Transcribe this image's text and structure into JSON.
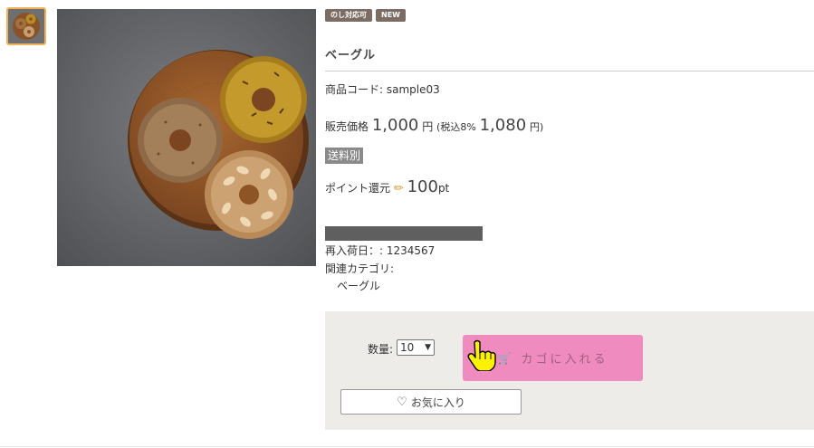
{
  "product": {
    "badges": [
      "のし対応可",
      "NEW"
    ],
    "title": "ベーグル",
    "code_label": "商品コード:",
    "code_value": "sample03",
    "price": {
      "label": "販売価格",
      "amount": "1,000",
      "yen": "円",
      "tax_open": "(税込8%",
      "tax_amount": "1,080",
      "tax_close": "円)"
    },
    "shipping": "送料別",
    "point": {
      "label": "ポイント還元",
      "icon": "pencil-icon",
      "amount": "100",
      "unit": "pt"
    },
    "restock": "再入荷日：: 1234567",
    "category_label": "関連カテゴリ:",
    "category_item": "ベーグル"
  },
  "cart": {
    "qty_label": "数量:",
    "qty_value": "10",
    "add_label": "カゴに入れる",
    "favorite_label": "お気に入り"
  },
  "colors": {
    "badge": "#7b6d63",
    "cart_button": "#f08bc0",
    "cart_panel": "#eeece9",
    "thumb_border": "#f0b15a"
  }
}
